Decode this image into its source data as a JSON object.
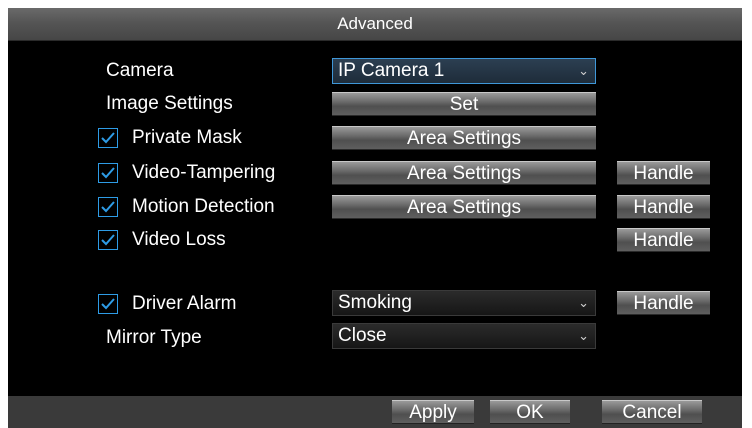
{
  "window": {
    "title": "Advanced"
  },
  "camera": {
    "label": "Camera",
    "value": "IP Camera 1"
  },
  "image_settings": {
    "label": "Image Settings",
    "button": "Set"
  },
  "private_mask": {
    "label": "Private Mask",
    "checked": true,
    "button": "Area Settings"
  },
  "video_tampering": {
    "label": "Video-Tampering",
    "checked": true,
    "button": "Area Settings",
    "handle": "Handle"
  },
  "motion_detection": {
    "label": "Motion Detection",
    "checked": true,
    "button": "Area Settings",
    "handle": "Handle"
  },
  "video_loss": {
    "label": "Video Loss",
    "checked": true,
    "handle": "Handle"
  },
  "driver_alarm": {
    "label": "Driver Alarm",
    "checked": true,
    "value": "Smoking",
    "handle": "Handle"
  },
  "mirror_type": {
    "label": "Mirror Type",
    "value": "Close"
  },
  "footer": {
    "apply": "Apply",
    "ok": "OK",
    "cancel": "Cancel"
  },
  "colors": {
    "checkbox_accent": "#2e9ce6",
    "background": "#000000",
    "focus_border": "#3f97d8"
  },
  "icons": {
    "checkbox": "checkmark-icon",
    "dropdown": "chevron-down-icon"
  }
}
